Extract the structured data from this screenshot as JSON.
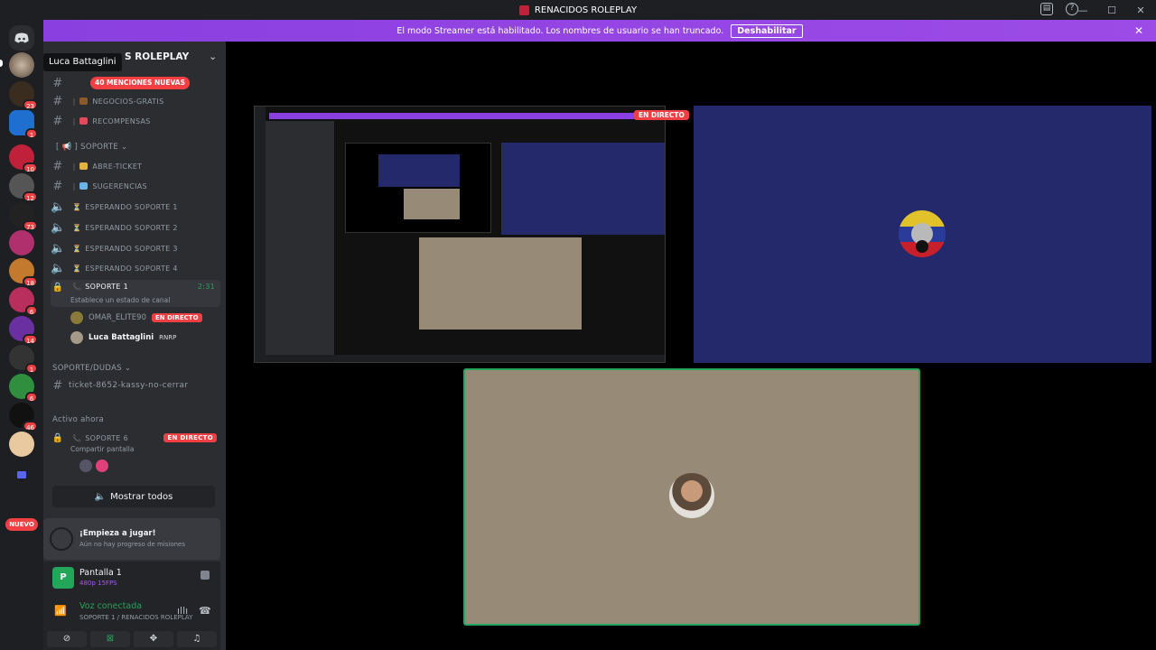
{
  "window": {
    "title": "RENACIDOS ROLEPLAY",
    "controls": [
      "—",
      "☐",
      "✕"
    ]
  },
  "banner": {
    "message": "El modo Streamer está habilitado. Los nombres de usuario se han truncado.",
    "disable_label": "Deshabilitar"
  },
  "serverbar": {
    "badges": [
      "23",
      "1",
      "10",
      "12",
      "73",
      "18",
      "6",
      "14",
      "1",
      "6",
      "46"
    ],
    "nuevo_label": "NUEVO"
  },
  "server": {
    "name": "S ROLEPLAY",
    "tooltip": "Luca Battaglini",
    "mentions": "40 MENCIONES NUEVAS"
  },
  "channels": {
    "top": [
      {
        "name": "NEGOCIOS-GRATIS"
      },
      {
        "name": "RECOMPENSAS"
      }
    ],
    "soporte_category": "SOPORTE",
    "soporte": [
      {
        "name": "ABRE-TICKET"
      },
      {
        "name": "SUGERENCIAS"
      },
      {
        "name": "ESPERANDO SOPORTE 1"
      },
      {
        "name": "ESPERANDO SOPORTE 2"
      },
      {
        "name": "ESPERANDO SOPORTE 3"
      },
      {
        "name": "ESPERANDO SOPORTE 4"
      }
    ],
    "active_voice": {
      "name": "SOPORTE 1",
      "timer": "2:31",
      "status": "Establece un estado de canal"
    },
    "voice_users": [
      {
        "name": "OMAR_ELITE90",
        "tag": "EN DIRECTO"
      },
      {
        "name": "Luca Battaglini",
        "tag": "RNRP"
      }
    ],
    "dudas_category": "SOPORTE/DUDAS",
    "ticket": "ticket-8652-kassy-no-cerrar",
    "active_now_label": "Activo ahora",
    "soporte6": {
      "name": "SOPORTE 6",
      "sub": "Compartir pantalla",
      "tag": "EN DIRECTO"
    },
    "show_all": "Mostrar todos"
  },
  "quest": {
    "title": "¡Empieza a jugar!",
    "subtitle": "Aún no hay progreso de misiones"
  },
  "stream": {
    "icon_letter": "P",
    "title": "Pantalla 1",
    "quality": "480p 15FPS",
    "voice_title": "Voz conectada",
    "voice_sub": "SOPORTE 1 / RENACIDOS ROLEPLAY"
  },
  "stage": {
    "live_tag": "EN DIRECTO"
  },
  "colors": {
    "brand_red": "#f23f43",
    "online_green": "#23a55a",
    "streamer_purple": "#8a3fe0",
    "flag_bg": "#24296b",
    "cam_bg": "#978a76"
  }
}
